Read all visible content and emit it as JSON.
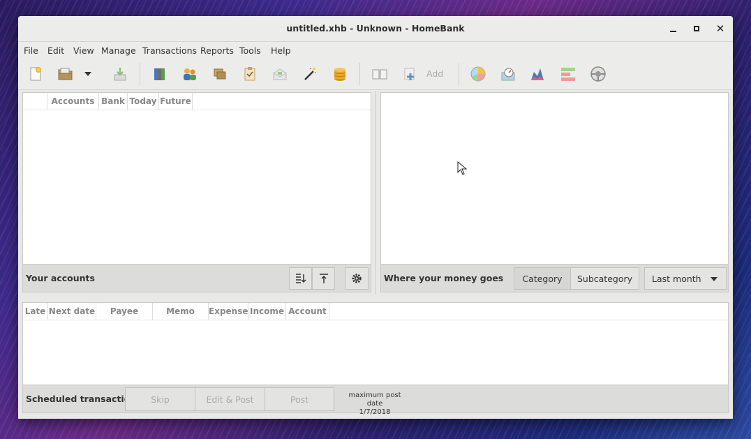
{
  "window": {
    "title": "untitled.xhb - Unknown - HomeBank"
  },
  "menu": [
    "File",
    "Edit",
    "View",
    "Manage",
    "Transactions",
    "Reports",
    "Tools",
    "Help"
  ],
  "toolbar": {
    "add_label": "Add",
    "icons": [
      "new-file-icon",
      "open-file-icon",
      "open-recent-dropdown-icon",
      "import-icon",
      "accounts-icon",
      "payees-icon",
      "categories-icon",
      "archives-icon",
      "budget-icon",
      "assistant-wand-icon",
      "currency-coins-icon",
      "register-book-icon",
      "add-transaction-icon",
      "statistics-pie-icon",
      "balance-report-icon",
      "trend-report-icon",
      "vehicle-cost-icon",
      "budget-report-icon"
    ]
  },
  "accounts": {
    "columns": [
      "Accounts",
      "Bank",
      "Today",
      "Future"
    ],
    "footer_label": "Your accounts"
  },
  "spending": {
    "footer_label": "Where your money goes",
    "toggle": [
      "Category",
      "Subcategory"
    ],
    "period": "Last month"
  },
  "scheduled": {
    "columns": [
      "Late",
      "Next date",
      "Payee",
      "Memo",
      "Expense",
      "Income",
      "Account"
    ],
    "footer_label": "Scheduled transactions",
    "skip_label": "Skip",
    "editpost_label": "Edit & Post",
    "post_label": "Post",
    "max_post_label": "maximum post date",
    "max_post_date": "1/7/2018"
  }
}
